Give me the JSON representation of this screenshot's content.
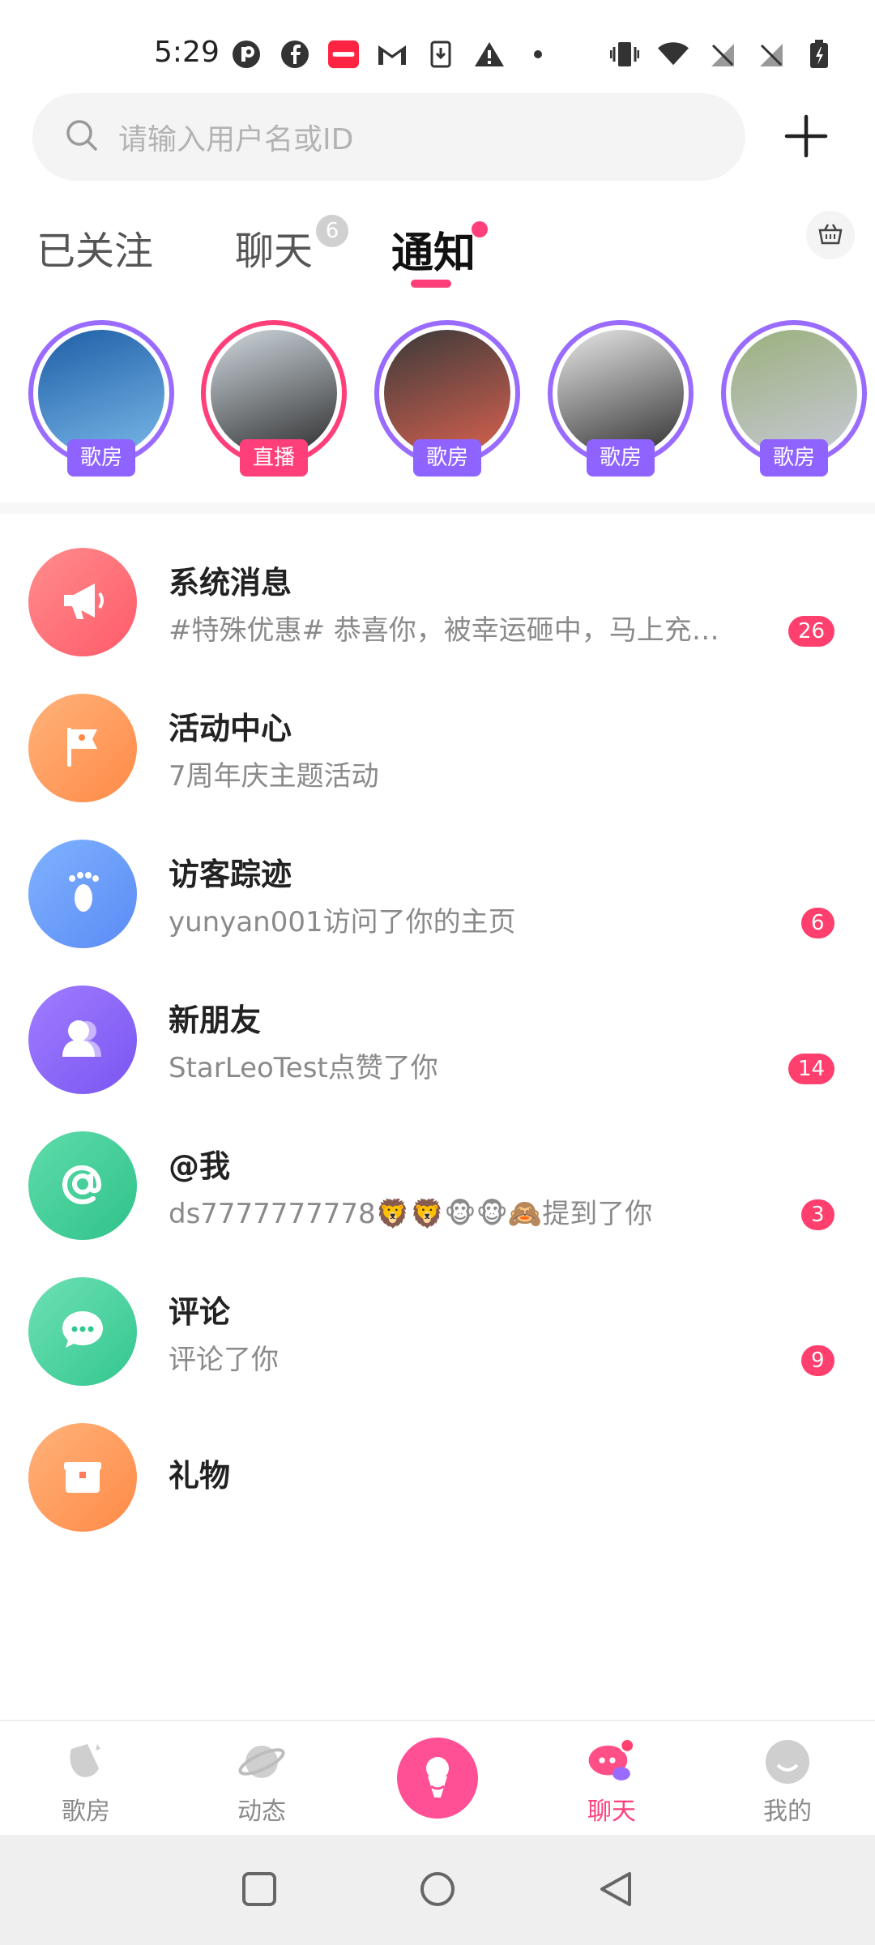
{
  "status_bar": {
    "time": "5:29"
  },
  "search": {
    "placeholder": "请输入用户名或ID"
  },
  "tabs": {
    "followed": "已关注",
    "chat": "聊天",
    "chat_count": "6",
    "notice": "通知"
  },
  "stories": [
    {
      "tag": "歌房",
      "kind": "room",
      "colors": [
        "#1e5ea6",
        "#79b8e8"
      ]
    },
    {
      "tag": "直播",
      "kind": "live",
      "colors": [
        "#cfd8df",
        "#2c2c2c"
      ]
    },
    {
      "tag": "歌房",
      "kind": "room",
      "colors": [
        "#3a3a3a",
        "#d9614f"
      ]
    },
    {
      "tag": "歌房",
      "kind": "room",
      "colors": [
        "#e8e8e8",
        "#2f2f2f"
      ]
    },
    {
      "tag": "歌房",
      "kind": "room",
      "colors": [
        "#9bb07d",
        "#c7c9d6"
      ]
    }
  ],
  "messages": [
    {
      "title": "系统消息",
      "subtitle": "#特殊优惠# 恭喜你，被幸运砸中，马上充…",
      "badge": "26",
      "icon": "megaphone-icon",
      "color_from": "#ff8d8d",
      "color_to": "#ff5a69"
    },
    {
      "title": "活动中心",
      "subtitle": "7周年庆主题活动",
      "badge": "",
      "icon": "flag-icon",
      "color_from": "#ffb27a",
      "color_to": "#ff8a47"
    },
    {
      "title": "访客踪迹",
      "subtitle": "yunyan001访问了你的主页",
      "badge": "6",
      "icon": "footprint-icon",
      "color_from": "#7fb2ff",
      "color_to": "#5b8bf5"
    },
    {
      "title": "新朋友",
      "subtitle": "StarLeoTest点赞了你",
      "badge": "14",
      "icon": "user-icon",
      "color_from": "#a07dff",
      "color_to": "#7a55f2"
    },
    {
      "title": "@我",
      "subtitle": "ds7777777778🦁🦁🐵🐵🙈提到了你",
      "badge": "3",
      "icon": "at-icon",
      "color_from": "#5fdcaa",
      "color_to": "#2fc28a"
    },
    {
      "title": "评论",
      "subtitle": "评论了你",
      "badge": "9",
      "icon": "comment-icon",
      "color_from": "#6ee0b4",
      "color_to": "#33c78f"
    },
    {
      "title": "礼物",
      "subtitle": "",
      "badge": "",
      "icon": "gift-icon",
      "color_from": "#ffb27a",
      "color_to": "#ff8a47"
    }
  ],
  "bottom_nav": {
    "items": [
      {
        "label": "歌房",
        "icon": "music-room-icon"
      },
      {
        "label": "动态",
        "icon": "planet-icon"
      },
      {
        "label": "聊天",
        "icon": "chat-bubble-icon"
      },
      {
        "label": "我的",
        "icon": "profile-icon"
      }
    ],
    "active": "聊天",
    "accent": "#ff3f7a"
  }
}
